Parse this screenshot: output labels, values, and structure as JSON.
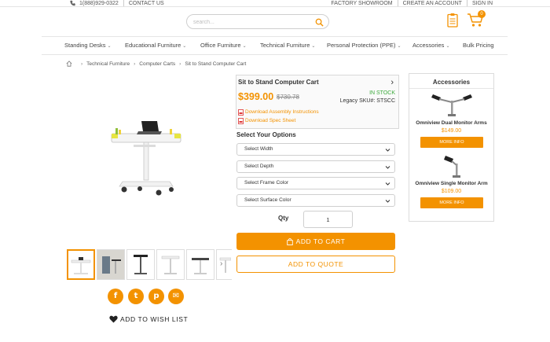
{
  "topbar": {
    "phone": "1(888)929-0322",
    "contact": "CONTACT US",
    "links": [
      "FACTORY SHOWROOM",
      "CREATE AN ACCOUNT",
      "SIGN IN"
    ]
  },
  "search": {
    "placeholder": "search..."
  },
  "cart": {
    "count": "0"
  },
  "nav": {
    "items": [
      {
        "label": "Standing Desks",
        "chevron": "⌄"
      },
      {
        "label": "Educational Furniture",
        "chevron": "⌄"
      },
      {
        "label": "Office Furniture",
        "chevron": "⌄"
      },
      {
        "label": "Technical Furniture",
        "chevron": "⌄"
      },
      {
        "label": "Personal Protection (PPE)",
        "chevron": "⌄"
      },
      {
        "label": "Accessories",
        "chevron": "⌄"
      },
      {
        "label": "Bulk Pricing",
        "chevron": ""
      }
    ]
  },
  "breadcrumb": [
    "Technical Furniture",
    "Computer Carts",
    "Sit to Stand Computer Cart"
  ],
  "product": {
    "title": "Sit to Stand Computer Cart",
    "price": "$399.00",
    "old_price": "$730.78",
    "stock": "IN STOCK",
    "sku": "Legacy SKU#: STSCC",
    "downloads": [
      "Download Assembly Instructions",
      "Download Spec Sheet"
    ]
  },
  "options": {
    "title": "Select Your Options",
    "selects": [
      "Select Width",
      "Select Depth",
      "Select Frame Color",
      "Select Surface Color"
    ]
  },
  "qty": {
    "label": "Qty",
    "value": "1"
  },
  "buttons": {
    "add_to_cart": "ADD TO CART",
    "add_to_quote": "ADD TO QUOTE"
  },
  "wishlist": "ADD TO WISH LIST",
  "social": {
    "facebook": "f",
    "twitter": "t",
    "pinterest": "p",
    "email": "✉"
  },
  "accessories": {
    "title": "Accessories",
    "items": [
      {
        "name": "Omniview Dual Monitor Arms",
        "price": "$149.00",
        "button": "MORE INFO"
      },
      {
        "name": "Omniview Single Monitor Arm",
        "price": "$109.00",
        "button": "MORE INFO"
      }
    ]
  },
  "colors": {
    "accent": "#f39200",
    "stock": "#3caa3c"
  }
}
